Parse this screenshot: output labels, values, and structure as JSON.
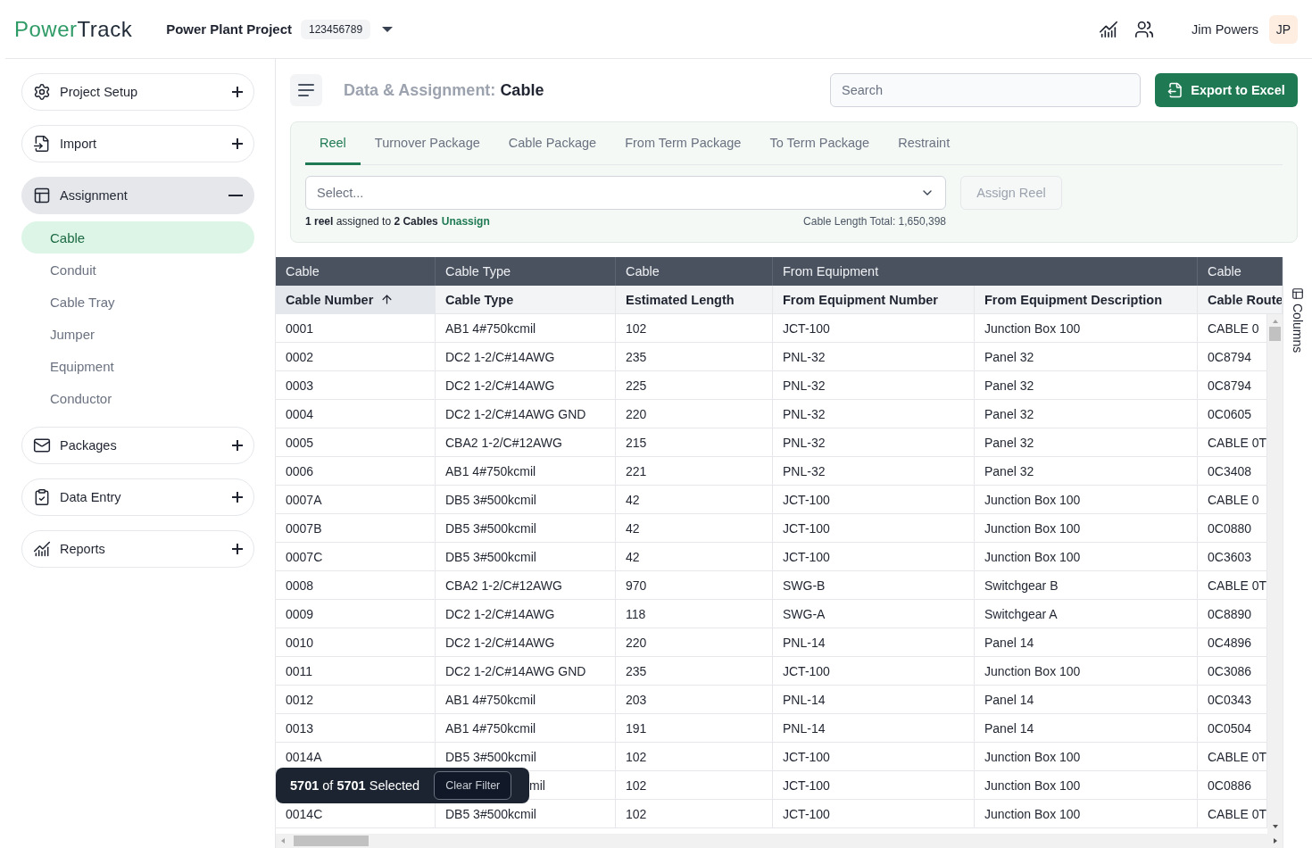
{
  "header": {
    "logo": {
      "first": "Power",
      "second": "Track"
    },
    "project": {
      "name": "Power Plant Project",
      "number": "123456789"
    },
    "user": {
      "name": "Jim Powers",
      "initials": "JP"
    }
  },
  "sidebar": {
    "sections": [
      {
        "label": "Project Setup",
        "expanded": false
      },
      {
        "label": "Import",
        "expanded": false
      },
      {
        "label": "Assignment",
        "expanded": true,
        "children": [
          {
            "label": "Cable",
            "selected": true
          },
          {
            "label": "Conduit",
            "selected": false
          },
          {
            "label": "Cable Tray",
            "selected": false
          },
          {
            "label": "Jumper",
            "selected": false
          },
          {
            "label": "Equipment",
            "selected": false
          },
          {
            "label": "Conductor",
            "selected": false
          }
        ]
      },
      {
        "label": "Packages",
        "expanded": false
      },
      {
        "label": "Data Entry",
        "expanded": false
      },
      {
        "label": "Reports",
        "expanded": false
      }
    ]
  },
  "toolbar": {
    "title_prefix": "Data & Assignment:",
    "title_subject": "Cable",
    "search": {
      "placeholder": "Search"
    },
    "export_button": "Export to Excel"
  },
  "assign_panel": {
    "tabs": [
      {
        "label": "Reel",
        "selected": true
      },
      {
        "label": "Turnover Package",
        "selected": false
      },
      {
        "label": "Cable Package",
        "selected": false
      },
      {
        "label": "From Term Package",
        "selected": false
      },
      {
        "label": "To Term Package",
        "selected": false
      },
      {
        "label": "Restraint",
        "selected": false
      }
    ],
    "select": {
      "placeholder": "Select..."
    },
    "assign_button": {
      "label": "Assign Reel",
      "disabled": true
    },
    "status": "**1 reel** assigned to **2 Cables**",
    "unassign_link": "Unassign",
    "length_total": "Cable Length Total: 1,650,398"
  },
  "table": {
    "groups": [
      {
        "label": "Cable",
        "columns": [
          {
            "label": "Cable Number",
            "sorted": true
          }
        ]
      },
      {
        "label": "Cable Type",
        "columns": [
          {
            "label": "Cable Type",
            "sorted": false
          }
        ]
      },
      {
        "label": "Cable",
        "columns": [
          {
            "label": "Estimated Length",
            "sorted": false
          }
        ]
      },
      {
        "label": "From Equipment",
        "columns": [
          {
            "label": "From Equipment Number",
            "sorted": false
          },
          {
            "label": "From Equipment Description",
            "sorted": false
          }
        ]
      },
      {
        "label": "Cable",
        "columns": [
          {
            "label": "Cable Route",
            "sorted": false
          }
        ]
      }
    ],
    "rows": [
      {
        "covered": false,
        "cells": [
          "0001",
          "AB1 4#750kcmil",
          "102",
          "JCT-100",
          "Junction Box 100",
          "CABLE 0"
        ]
      },
      {
        "covered": false,
        "cells": [
          "0002",
          "DC2 1-2/C#14AWG",
          "235",
          "PNL-32",
          "Panel 32",
          "0C8794"
        ]
      },
      {
        "covered": false,
        "cells": [
          "0003",
          "DC2 1-2/C#14AWG",
          "225",
          "PNL-32",
          "Panel 32",
          "0C8794"
        ]
      },
      {
        "covered": false,
        "cells": [
          "0004",
          "DC2 1-2/C#14AWG GND",
          "220",
          "PNL-32",
          "Panel 32",
          "0C0605"
        ]
      },
      {
        "covered": false,
        "cells": [
          "0005",
          "CBA2 1-2/C#12AWG",
          "215",
          "PNL-32",
          "Panel 32",
          "CABLE 0T"
        ]
      },
      {
        "covered": false,
        "cells": [
          "0006",
          "AB1 4#750kcmil",
          "221",
          "PNL-32",
          "Panel 32",
          "0C3408"
        ]
      },
      {
        "covered": false,
        "cells": [
          "0007A",
          "DB5 3#500kcmil",
          "42",
          "JCT-100",
          "Junction Box 100",
          "CABLE 0"
        ]
      },
      {
        "covered": false,
        "cells": [
          "0007B",
          "DB5 3#500kcmil",
          "42",
          "JCT-100",
          "Junction Box 100",
          "0C0880"
        ]
      },
      {
        "covered": false,
        "cells": [
          "0007C",
          "DB5 3#500kcmil",
          "42",
          "JCT-100",
          "Junction Box 100",
          "0C3603"
        ]
      },
      {
        "covered": false,
        "cells": [
          "0008",
          "CBA2 1-2/C#12AWG",
          "970",
          "SWG-B",
          "Switchgear B",
          "CABLE 0T"
        ]
      },
      {
        "covered": false,
        "cells": [
          "0009",
          "DC2 1-2/C#14AWG",
          "118",
          "SWG-A",
          "Switchgear A",
          "0C8890"
        ]
      },
      {
        "covered": false,
        "cells": [
          "0010",
          "DC2 1-2/C#14AWG",
          "220",
          "PNL-14",
          "Panel 14",
          "0C4896"
        ]
      },
      {
        "covered": false,
        "cells": [
          "0011",
          "DC2 1-2/C#14AWG GND",
          "235",
          "JCT-100",
          "Junction Box 100",
          "0C3086"
        ]
      },
      {
        "covered": false,
        "cells": [
          "0012",
          "AB1 4#750kcmil",
          "203",
          "PNL-14",
          "Panel 14",
          "0C0343"
        ]
      },
      {
        "covered": false,
        "cells": [
          "0013",
          "AB1 4#750kcmil",
          "191",
          "PNL-14",
          "Panel 14",
          "0C0504"
        ]
      },
      {
        "covered": false,
        "cells": [
          "0014A",
          "DB5 3#500kcmil",
          "102",
          "JCT-100",
          "Junction Box 100",
          "CABLE 0T"
        ]
      },
      {
        "covered": true,
        "cells": [
          "",
          "mil",
          "102",
          "JCT-100",
          "Junction Box 100",
          "0C0886"
        ]
      },
      {
        "covered": false,
        "cells": [
          "0014C",
          "DB5 3#500kcmil",
          "102",
          "JCT-100",
          "Junction Box 100",
          "CABLE 0T"
        ]
      }
    ],
    "columns_panel": "Columns"
  },
  "selection_bar": {
    "text": "**5701** of **5701** Selected",
    "clear_button": "Clear Filter"
  }
}
